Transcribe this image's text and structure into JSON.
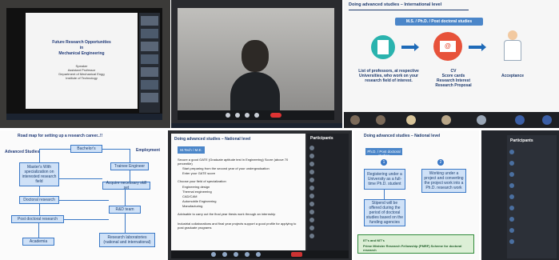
{
  "p1": {
    "slide_title": "Future Research Opportunities in Mechanical Engineering",
    "slide_title_line1": "Future Research Opportunities",
    "slide_title_line2": "in",
    "slide_title_line3": "Mechanical Engineering",
    "presenter_lines": [
      "Speaker",
      "Assistant Professor",
      "Department of Mechanical Engg",
      "Institute of Technology"
    ]
  },
  "p3": {
    "header": "Doing advanced studies – International level",
    "tag": "M.S. / Ph.D. / Post doctoral studies",
    "caption1": "List of professors, at respective Universities, who work on your research field of interest.",
    "caption2": "CV\nScore cards\nResearch Interest\nResearch Proposal",
    "caption2_lines": [
      "CV",
      "Score cards",
      "Research Interest",
      "Research Proposal"
    ],
    "caption3": "Acceptance"
  },
  "p4": {
    "title": "Road map for setting up a research career..!!",
    "left_label": "Advanced Studies",
    "right_label": "Employment",
    "boxes": {
      "bachelors": "Bachelor's",
      "masters": "Master's With specialization on interested research field",
      "trainee": "Trainee Engineer",
      "doctoral": "Doctoral research",
      "acquire": "Acquire necessary skill set",
      "rnd": "R&D team",
      "postdoc": "Post doctoral research",
      "academia": "Academia",
      "research_labs": "Research laboratories (national and international)"
    }
  },
  "p5": {
    "header": "Doing advanced studies – National level",
    "tag": "M.Tech / M.E.",
    "paragraph1": "Secure a good GATE (Graduate aptitude test in Engineering) Score (above 70 percentile)",
    "bullets1": [
      "Start preparing from the second year of your undergraduation",
      "Enter your GATE score"
    ],
    "paragraph2": "Choose your field of specialization",
    "bullets2": [
      "Engineering design",
      "Thermal engineering",
      "CAD/CAM",
      "Automobile Engineering",
      "Manufacturing"
    ],
    "paragraph3": "Advisable to carry out the final year thesis work through an internship",
    "paragraph4": "Industrial collaborations and final year projects support a good profile for applying to post graduate programs",
    "participants_title": "Participants"
  },
  "p6": {
    "header": "Doing advanced studies – National level",
    "tag": "Ph.D. / Post doctoral studies",
    "box1": "Registering under a University as a full-time Ph.D. student",
    "box2": "Working under a project and converting the project work into a Ph.D. research work",
    "box3": "Stipend will be offered during the period of doctoral studies based on the funding agencies",
    "num1": "1",
    "num2": "2",
    "footer_lines": [
      "IIT's and NIT's",
      "Prime Minister Research Fellowship (PMRF) Scheme for doctoral research"
    ]
  },
  "p7": {
    "participants_title": "Participants"
  }
}
